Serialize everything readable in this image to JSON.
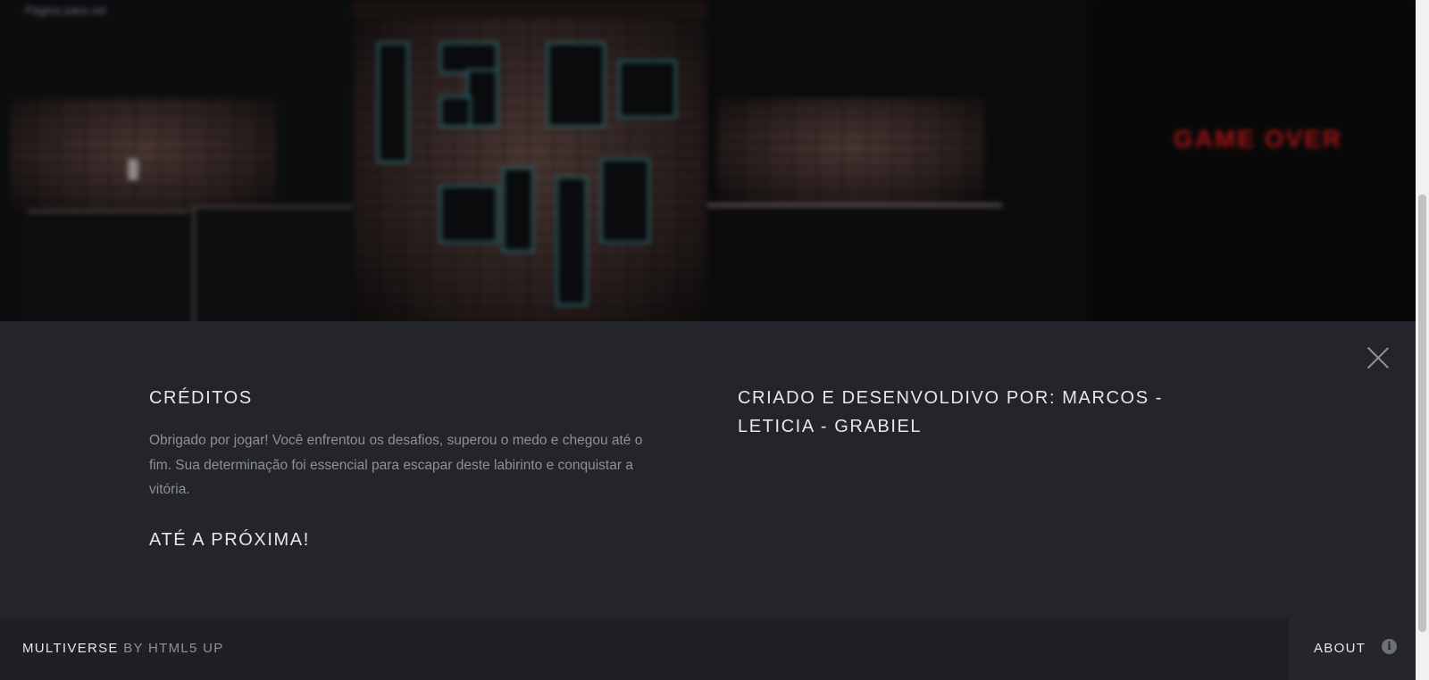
{
  "gallery": {
    "top_left_text": "Página para ver",
    "top_left_highlight": "",
    "thumbs": [
      {
        "caption": ""
      },
      {
        "caption": ""
      },
      {
        "caption": ""
      },
      {
        "caption": ""
      }
    ],
    "gameover_title": "GAME OVER",
    "gameover_sub": "",
    "gameover_sub2": ""
  },
  "panel": {
    "close_icon": "close-icon",
    "left_title": "CRÉDITOS",
    "left_text": "Obrigado por jogar! Você enfrentou os desafios, superou o medo e chegou até o fim. Sua determinação foi essencial para escapar deste labirinto e conquistar a vitória.",
    "left_farewell": "ATÉ A PRÓXIMA!",
    "right_title": "CRIADO E DESENVOLDIVO POR: MARCOS - LETICIA - GRABIEL"
  },
  "footer": {
    "brand_strong": "MULTIVERSE",
    "brand_rest": " BY HTML5 UP",
    "about_label": "ABOUT",
    "about_icon": "info-icon"
  },
  "colors": {
    "panel_bg": "#24262c",
    "footer_bg": "#1e2025",
    "heading": "#e6e7ea",
    "body_text": "#8d9096",
    "gameover_red": "#a01414",
    "maze_teal": "#2b5b5e"
  }
}
